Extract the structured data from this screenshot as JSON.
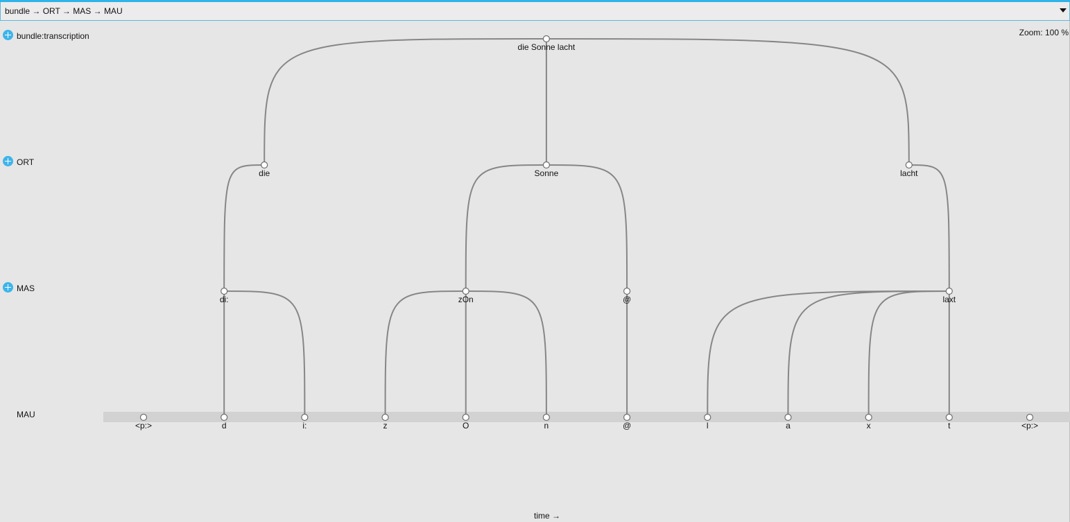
{
  "path_selector": {
    "value": "bundle → ORT → MAS → MAU"
  },
  "zoom": {
    "label": "Zoom: 100 %"
  },
  "levels": [
    {
      "name": "bundle:transcription",
      "has_add_button": true
    },
    {
      "name": "ORT",
      "has_add_button": true
    },
    {
      "name": "MAS",
      "has_add_button": true
    },
    {
      "name": "MAU",
      "has_add_button": false
    }
  ],
  "time_axis": {
    "label": "time →"
  },
  "hierarchy": {
    "bundle": [
      {
        "label": "die Sonne lacht",
        "children": [
          0,
          1,
          2
        ]
      }
    ],
    "ORT": [
      {
        "label": "die",
        "children": [
          0
        ]
      },
      {
        "label": "Sonne",
        "children": [
          1,
          2
        ]
      },
      {
        "label": "lacht",
        "children": [
          3
        ]
      }
    ],
    "MAS": [
      {
        "label": "di:",
        "children": [
          1,
          2
        ]
      },
      {
        "label": "zOn",
        "children": [
          3,
          4,
          5
        ]
      },
      {
        "label": "@",
        "children": [
          6
        ]
      },
      {
        "label": "laxt",
        "children": [
          7,
          8,
          9,
          10
        ]
      }
    ],
    "MAU": [
      {
        "label": "<p:>"
      },
      {
        "label": "d"
      },
      {
        "label": "i:"
      },
      {
        "label": "z"
      },
      {
        "label": "O"
      },
      {
        "label": "n"
      },
      {
        "label": "@"
      },
      {
        "label": "l"
      },
      {
        "label": "a"
      },
      {
        "label": "x"
      },
      {
        "label": "t"
      },
      {
        "label": "<p:>"
      }
    ]
  },
  "colors": {
    "accent": "#2fb3e8",
    "edge": "#868686",
    "background": "#e6e6e6",
    "leaf_band": "#d2d2d2"
  }
}
